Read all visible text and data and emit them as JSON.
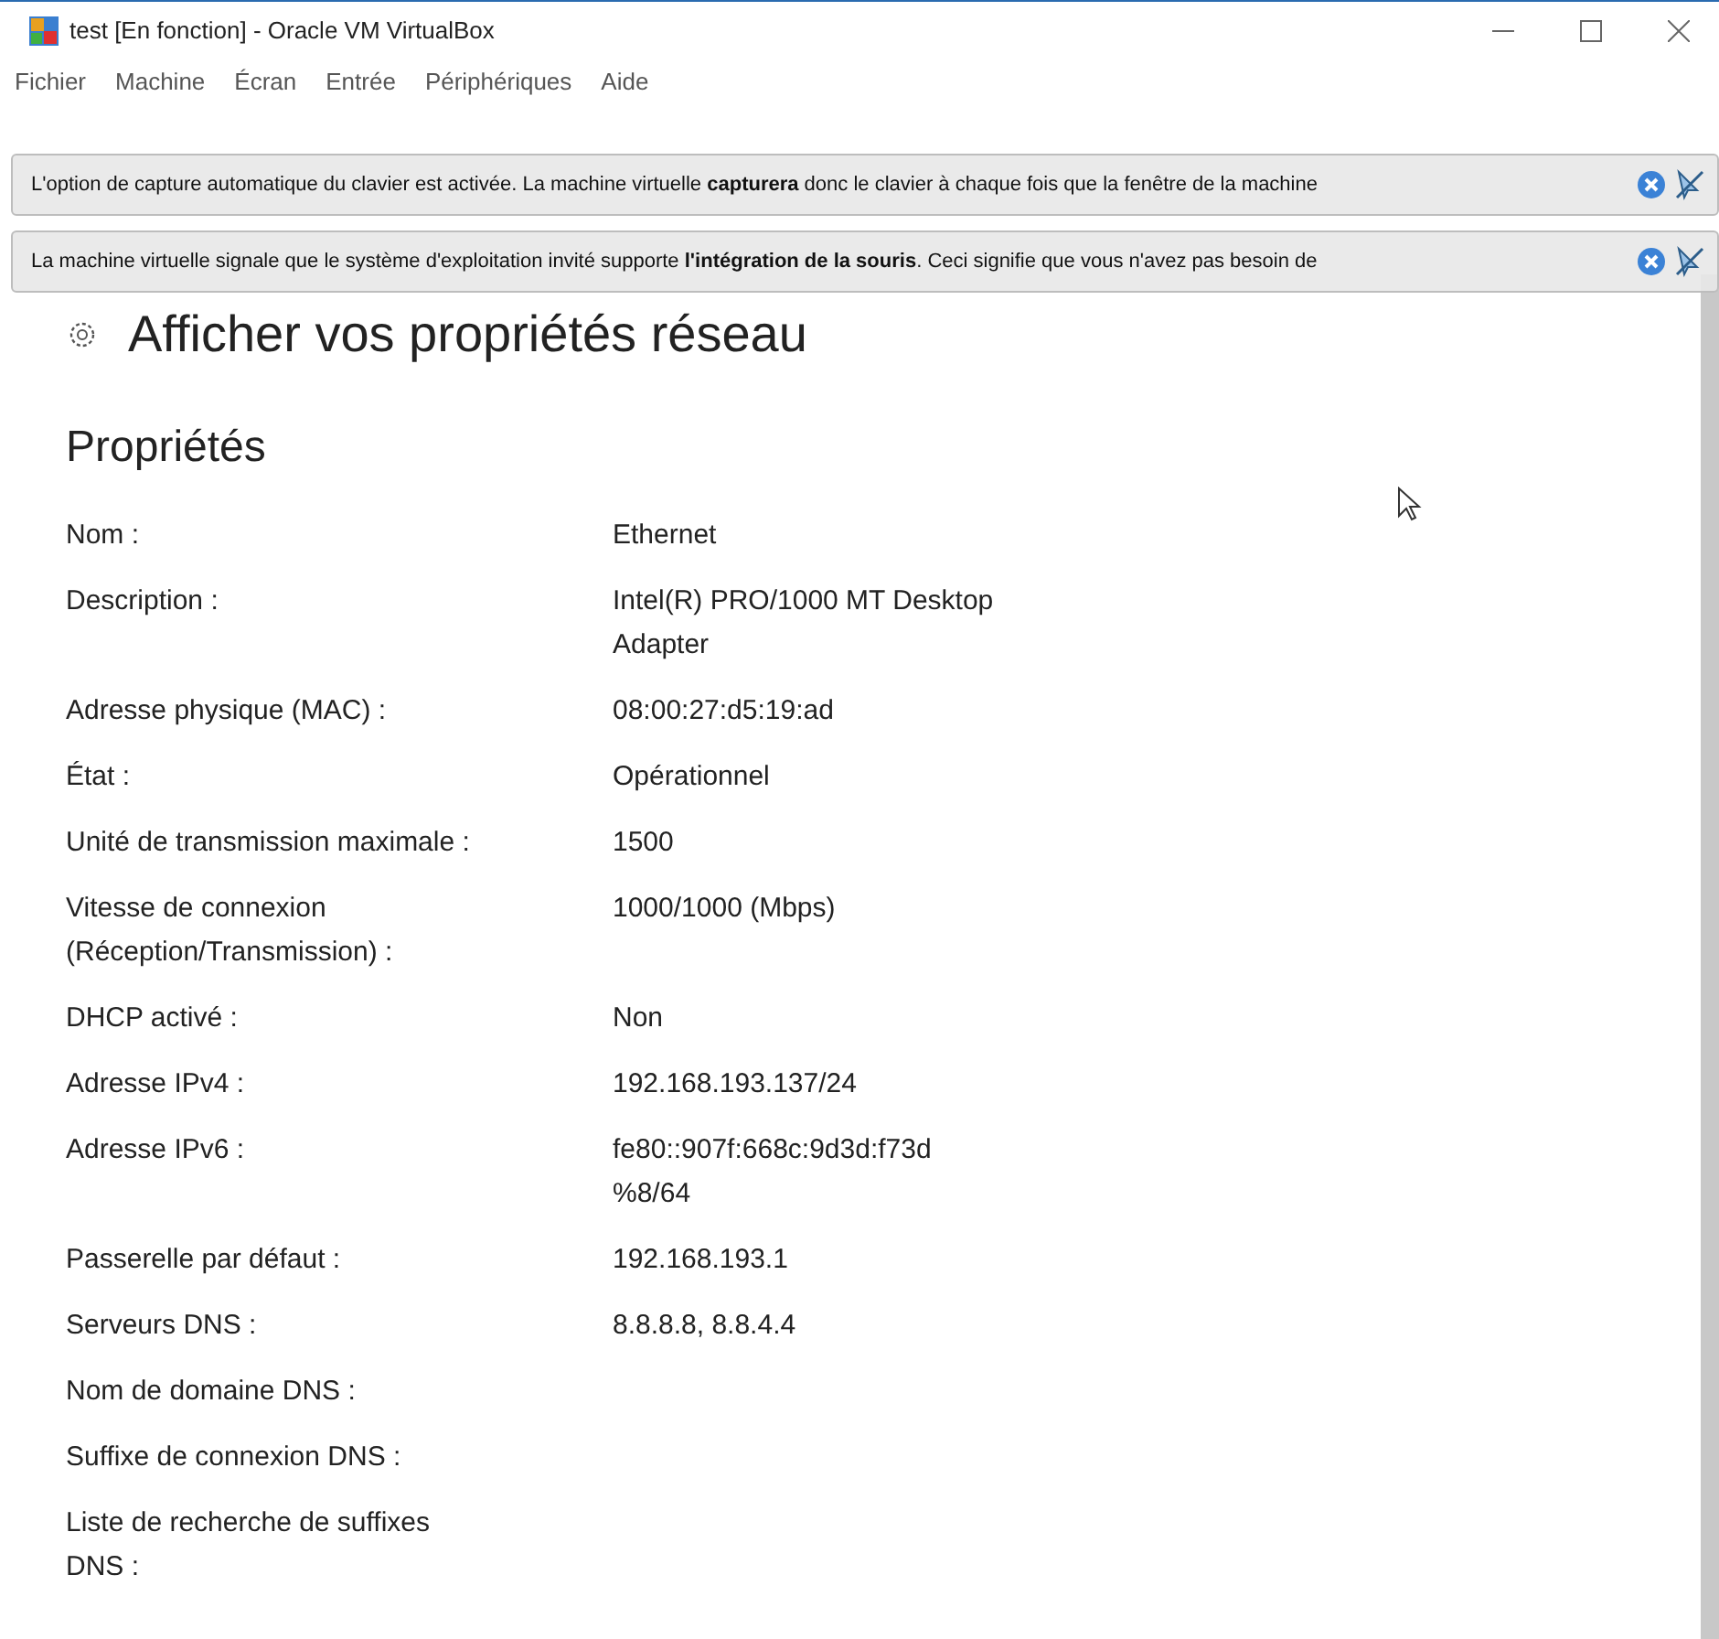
{
  "window": {
    "title": "test [En fonction] - Oracle VM VirtualBox"
  },
  "menu": [
    "Fichier",
    "Machine",
    "Écran",
    "Entrée",
    "Périphériques",
    "Aide"
  ],
  "notifications": [
    {
      "text": "L'option de capture automatique du clavier est activée. La machine virtuelle **capturera** donc le clavier à chaque fois que la fenêtre de la machine"
    },
    {
      "text": "La machine virtuelle signale que le système d'exploitation invité supporte **l'intégration de la souris**. Ceci signifie que vous n'avez pas besoin de"
    }
  ],
  "page": {
    "title": "Afficher vos propriétés réseau",
    "section": "Propriétés",
    "rows": [
      {
        "label": "Nom :",
        "value": "Ethernet"
      },
      {
        "label": "Description :",
        "value": "Intel(R) PRO/1000 MT Desktop Adapter"
      },
      {
        "label": "Adresse physique (MAC) :",
        "value": "08:00:27:d5:19:ad"
      },
      {
        "label": "État :",
        "value": "Opérationnel"
      },
      {
        "label": "Unité de transmission maximale :",
        "value": "1500"
      },
      {
        "label": "Vitesse de connexion (Réception/Transmission) :",
        "value": "1000/1000 (Mbps)"
      },
      {
        "label": "DHCP activé :",
        "value": "Non"
      },
      {
        "label": "Adresse IPv4 :",
        "value": "192.168.193.137/24"
      },
      {
        "label": "Adresse IPv6 :",
        "value": "fe80::907f:668c:9d3d:f73d %8/64"
      },
      {
        "label": "Passerelle par défaut :",
        "value": "192.168.193.1"
      },
      {
        "label": "Serveurs DNS :",
        "value": "8.8.8.8, 8.8.4.4"
      },
      {
        "label": "Nom de domaine DNS :"
      },
      {
        "label": "Suffixe de connexion DNS :"
      },
      {
        "label": "Liste de recherche de suffixes DNS :"
      }
    ]
  }
}
